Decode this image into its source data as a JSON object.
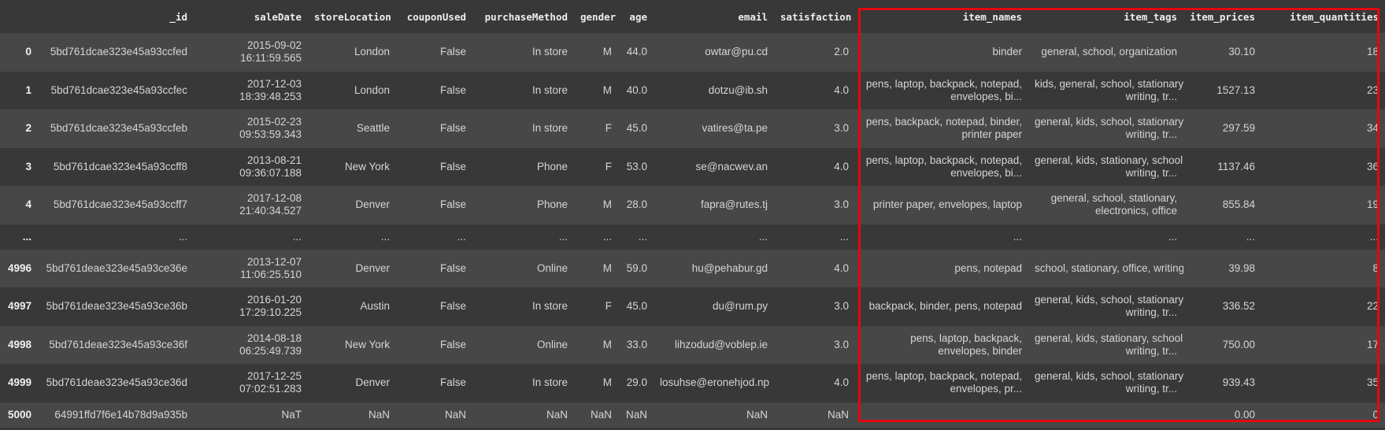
{
  "columns": [
    "",
    "_id",
    "saleDate",
    "storeLocation",
    "couponUsed",
    "purchaseMethod",
    "gender",
    "age",
    "email",
    "satisfaction",
    "item_names",
    "item_tags",
    "item_prices",
    "item_quantities"
  ],
  "rows": [
    {
      "idx": "0",
      "id": "5bd761dcae323e45a93ccfed",
      "date1": "2015-09-02",
      "date2": "16:11:59.565",
      "store": "London",
      "coupon": "False",
      "method": "In store",
      "gender": "M",
      "age": "44.0",
      "email": "owtar@pu.cd",
      "sat": "2.0",
      "names1": "binder",
      "names2": "",
      "tags1": "general, school, organization",
      "tags2": "",
      "price": "30.10",
      "qty": "18"
    },
    {
      "idx": "1",
      "id": "5bd761dcae323e45a93ccfec",
      "date1": "2017-12-03",
      "date2": "18:39:48.253",
      "store": "London",
      "coupon": "False",
      "method": "In store",
      "gender": "M",
      "age": "40.0",
      "email": "dotzu@ib.sh",
      "sat": "4.0",
      "names1": "pens, laptop, backpack, notepad,",
      "names2": "envelopes, bi...",
      "tags1": "kids, general, school, stationary,",
      "tags2": "writing, tr...",
      "price": "1527.13",
      "qty": "23"
    },
    {
      "idx": "2",
      "id": "5bd761dcae323e45a93ccfeb",
      "date1": "2015-02-23",
      "date2": "09:53:59.343",
      "store": "Seattle",
      "coupon": "False",
      "method": "In store",
      "gender": "F",
      "age": "45.0",
      "email": "vatires@ta.pe",
      "sat": "3.0",
      "names1": "pens, backpack, notepad, binder,",
      "names2": "printer paper",
      "tags1": "general, kids, school, stationary,",
      "tags2": "writing, tr...",
      "price": "297.59",
      "qty": "34"
    },
    {
      "idx": "3",
      "id": "5bd761dcae323e45a93ccff8",
      "date1": "2013-08-21",
      "date2": "09:36:07.188",
      "store": "New York",
      "coupon": "False",
      "method": "Phone",
      "gender": "F",
      "age": "53.0",
      "email": "se@nacwev.an",
      "sat": "4.0",
      "names1": "pens, laptop, backpack, notepad,",
      "names2": "envelopes, bi...",
      "tags1": "general, kids, stationary, school,",
      "tags2": "writing, tr...",
      "price": "1137.46",
      "qty": "36"
    },
    {
      "idx": "4",
      "id": "5bd761dcae323e45a93ccff7",
      "date1": "2017-12-08",
      "date2": "21:40:34.527",
      "store": "Denver",
      "coupon": "False",
      "method": "Phone",
      "gender": "M",
      "age": "28.0",
      "email": "fapra@rutes.tj",
      "sat": "3.0",
      "names1": "printer paper, envelopes, laptop",
      "names2": "",
      "tags1": "general, school, stationary,",
      "tags2": "electronics, office",
      "price": "855.84",
      "qty": "19"
    },
    {
      "idx": "...",
      "id": "...",
      "date1": "...",
      "date2": "",
      "store": "...",
      "coupon": "...",
      "method": "...",
      "gender": "...",
      "age": "...",
      "email": "...",
      "sat": "...",
      "names1": "...",
      "names2": "",
      "tags1": "...",
      "tags2": "",
      "price": "...",
      "qty": "..."
    },
    {
      "idx": "4996",
      "id": "5bd761deae323e45a93ce36e",
      "date1": "2013-12-07",
      "date2": "11:06:25.510",
      "store": "Denver",
      "coupon": "False",
      "method": "Online",
      "gender": "M",
      "age": "59.0",
      "email": "hu@pehabur.gd",
      "sat": "4.0",
      "names1": "pens, notepad",
      "names2": "",
      "tags1": "school, stationary, office, writing",
      "tags2": "",
      "price": "39.98",
      "qty": "8"
    },
    {
      "idx": "4997",
      "id": "5bd761deae323e45a93ce36b",
      "date1": "2016-01-20",
      "date2": "17:29:10.225",
      "store": "Austin",
      "coupon": "False",
      "method": "In store",
      "gender": "F",
      "age": "45.0",
      "email": "du@rum.py",
      "sat": "3.0",
      "names1": "backpack, binder, pens, notepad",
      "names2": "",
      "tags1": "general, kids, school, stationary,",
      "tags2": "writing, tr...",
      "price": "336.52",
      "qty": "22"
    },
    {
      "idx": "4998",
      "id": "5bd761deae323e45a93ce36f",
      "date1": "2014-08-18",
      "date2": "06:25:49.739",
      "store": "New York",
      "coupon": "False",
      "method": "Online",
      "gender": "M",
      "age": "33.0",
      "email": "lihzodud@voblep.ie",
      "sat": "3.0",
      "names1": "pens, laptop, backpack,",
      "names2": "envelopes, binder",
      "tags1": "general, kids, stationary, school,",
      "tags2": "writing, tr...",
      "price": "750.00",
      "qty": "17"
    },
    {
      "idx": "4999",
      "id": "5bd761deae323e45a93ce36d",
      "date1": "2017-12-25",
      "date2": "07:02:51.283",
      "store": "Denver",
      "coupon": "False",
      "method": "In store",
      "gender": "M",
      "age": "29.0",
      "email": "losuhse@eronehjod.np",
      "sat": "4.0",
      "names1": "pens, laptop, backpack, notepad,",
      "names2": "envelopes, pr...",
      "tags1": "general, kids, school, stationary,",
      "tags2": "writing, tr...",
      "price": "939.43",
      "qty": "35"
    },
    {
      "idx": "5000",
      "id": "64991ffd7f6e14b78d9a935b",
      "date1": "NaT",
      "date2": "",
      "store": "NaN",
      "coupon": "NaN",
      "method": "NaN",
      "gender": "NaN",
      "age": "NaN",
      "email": "NaN",
      "sat": "NaN",
      "names1": "",
      "names2": "",
      "tags1": "",
      "tags2": "",
      "price": "0.00",
      "qty": "0"
    }
  ],
  "highlight_color": "#e3080b"
}
